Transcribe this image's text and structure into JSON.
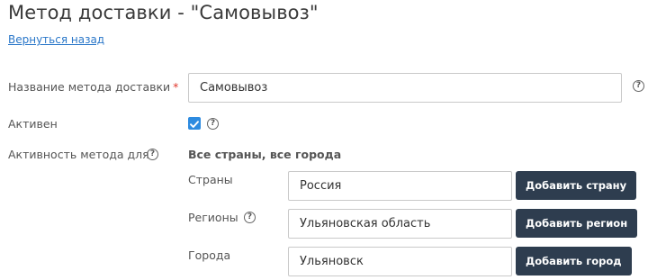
{
  "page": {
    "title": "Метод доставки - \"Самовывоз\"",
    "back_link": "Вернуться назад"
  },
  "form": {
    "method_name_label": "Название метода доставки",
    "required_mark": "*",
    "method_name_value": "Самовывоз",
    "active_label": "Активен",
    "active_checked": true,
    "activity_label": "Активность метода для",
    "activity_summary": "Все страны, все города",
    "countries_label": "Страны",
    "countries_value": "Россия",
    "add_country_button": "Добавить страну",
    "regions_label": "Регионы",
    "regions_value": "Ульяновская область",
    "add_region_button": "Добавить регион",
    "cities_label": "Города",
    "cities_value": "Ульяновск",
    "add_city_button": "Добавить город"
  },
  "icons": {
    "help": "help-icon",
    "check": "checkmark-icon"
  },
  "colors": {
    "link": "#2a77c9",
    "button_bg": "#2e3d4f",
    "checkbox": "#2d8be0",
    "required": "#e0362b"
  }
}
